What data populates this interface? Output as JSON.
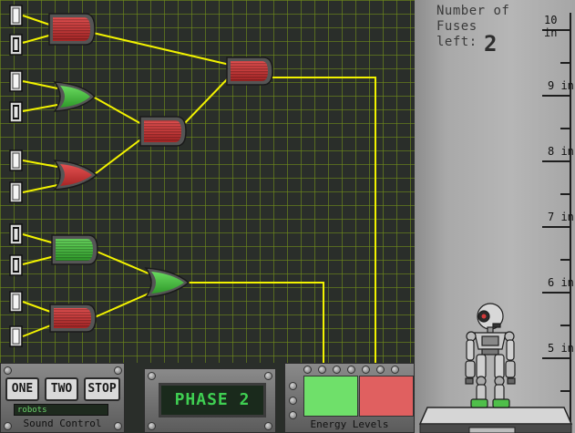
{
  "game": {
    "phase_label": "PHASE 2"
  },
  "fuses": {
    "label": "Number of\nFuses\nleft:",
    "count": "2"
  },
  "ruler": {
    "marks": [
      {
        "label": "10 in"
      },
      {
        "label": "9 in"
      },
      {
        "label": "8 in"
      },
      {
        "label": "7 in"
      },
      {
        "label": "6 in"
      },
      {
        "label": "5 in"
      }
    ]
  },
  "sound": {
    "btn_one": "ONE",
    "btn_two": "TWO",
    "btn_stop": "STOP",
    "track_text": "robots",
    "label": "Sound Control"
  },
  "energy": {
    "label": "Energy Levels",
    "green_color": "#6fe06a",
    "red_color": "#e06060"
  },
  "colors": {
    "board_bg": "#2a2e2a",
    "grid": "#6f8a1a",
    "wire": "#f2f200",
    "gate_red": "#d23a3a",
    "gate_green": "#3fbf3a"
  }
}
